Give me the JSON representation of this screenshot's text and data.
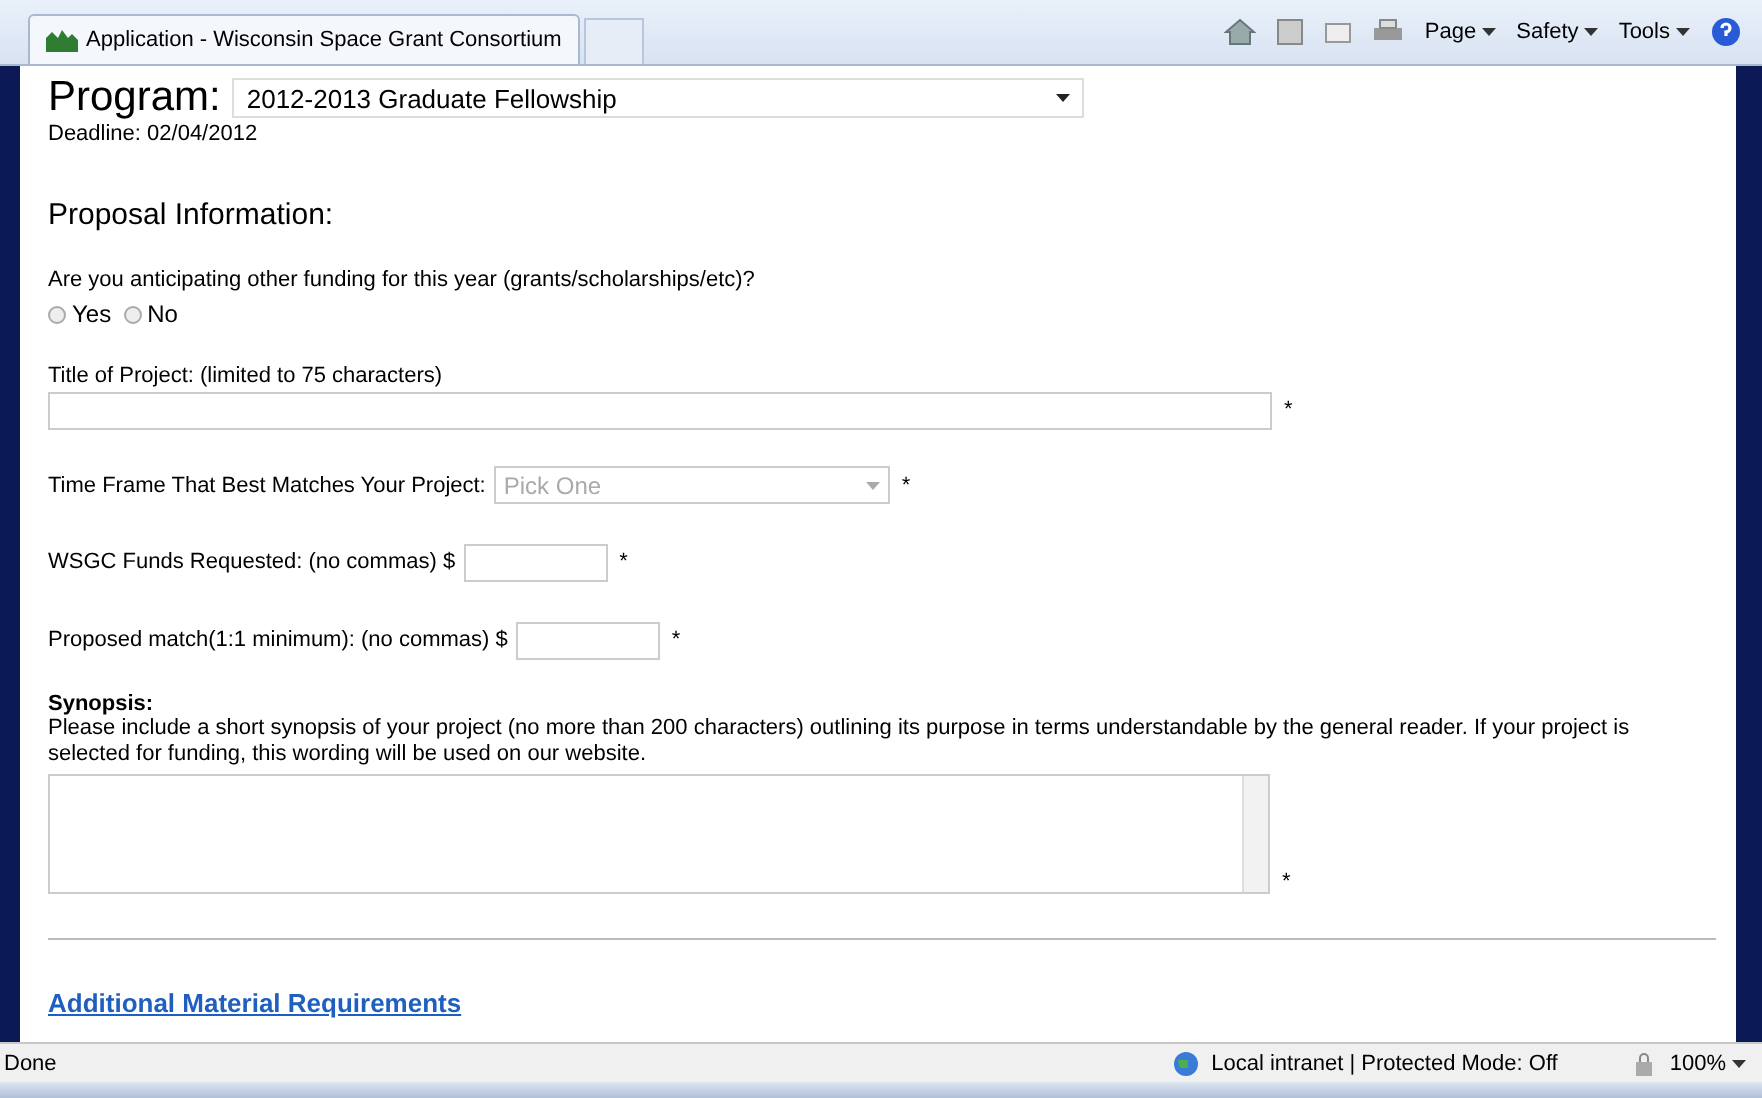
{
  "browser": {
    "tab_title": "Application - Wisconsin Space Grant Consortium",
    "commands": [
      "Page",
      "Safety",
      "Tools"
    ]
  },
  "program": {
    "label": "Program:",
    "value": "2012-2013 Graduate Fellowship"
  },
  "deadline": "Deadline: 02/04/2012",
  "section_title": "Proposal Information:",
  "funding_question": {
    "label": "Are you anticipating other funding for this year (grants/scholarships/etc)?",
    "options": [
      {
        "label": "Yes",
        "selected": false
      },
      {
        "label": "No",
        "selected": false
      }
    ]
  },
  "fields": [
    {
      "kind": "text",
      "label": "Title of Project: (limited to 75 characters)",
      "required_mark": "*"
    },
    {
      "kind": "select",
      "label": "Time Frame That Best Matches Your Project:",
      "placeholder": "Pick One",
      "required_mark": "*"
    },
    {
      "kind": "money",
      "label": "WSGC Funds Requested: (no commas) $",
      "required_mark": "*"
    },
    {
      "kind": "money",
      "label": "Proposed match(1:1 minimum): (no commas) $",
      "required_mark": "*"
    }
  ],
  "synopsis": {
    "heading": "Synopsis:",
    "instructions": "Please include a short synopsis of your project (no more than 200 characters) outlining its purpose in terms understandable by the general reader. If your project is selected for funding, this wording will be used on our website.",
    "required_mark": "*"
  },
  "link": "Additional Material Requirements",
  "status_bar": {
    "status": "Done",
    "zone": "Local intranet | Protected Mode: Off",
    "zoom": "100%"
  }
}
